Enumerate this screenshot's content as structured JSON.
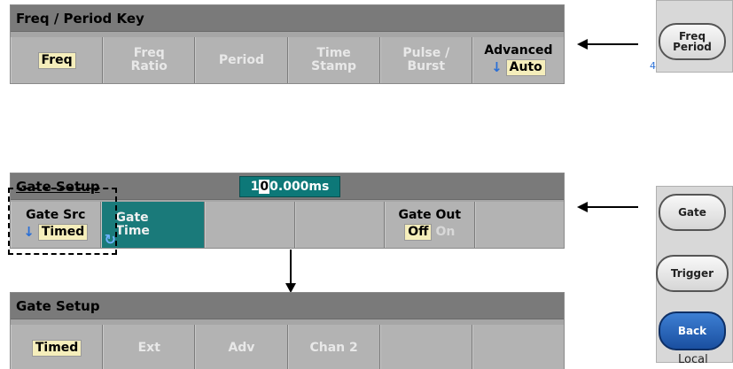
{
  "top": {
    "title": "Freq / Period Key",
    "keys": [
      {
        "line1": "Freq"
      },
      {
        "line1": "Freq",
        "line2": "Ratio"
      },
      {
        "line1": "Period"
      },
      {
        "line1": "Time",
        "line2": "Stamp"
      },
      {
        "line1": "Pulse /",
        "line2": "Burst"
      },
      {
        "line1": "Advanced",
        "arrow": "↓",
        "value": "Auto"
      }
    ],
    "button": {
      "line1": "Freq",
      "line2": "Period",
      "channel": "4"
    }
  },
  "middle": {
    "title": "Gate Setup",
    "value": "100.000ms",
    "keys": [
      {
        "line1": "Gate Src",
        "arrow": "↓",
        "value": "Timed"
      },
      {
        "line1": "Gate",
        "line2": "Time"
      },
      {
        "line1": ""
      },
      {
        "line1": ""
      },
      {
        "line1": "Gate Out",
        "off": "Off",
        "on": "On"
      },
      {
        "line1": ""
      }
    ],
    "button1": "Gate",
    "button2": "Trigger"
  },
  "bottom": {
    "title": "Gate Setup",
    "keys": [
      {
        "line1": "Timed"
      },
      {
        "line1": "Ext"
      },
      {
        "line1": "Adv"
      },
      {
        "line1": "Chan 2"
      },
      {
        "line1": ""
      },
      {
        "line1": ""
      }
    ]
  },
  "back": {
    "label": "Back",
    "local": "Local"
  },
  "colors": {
    "active": "#1a7a7a",
    "highlight": "#f5eebb",
    "back": "#1f5fb4"
  }
}
